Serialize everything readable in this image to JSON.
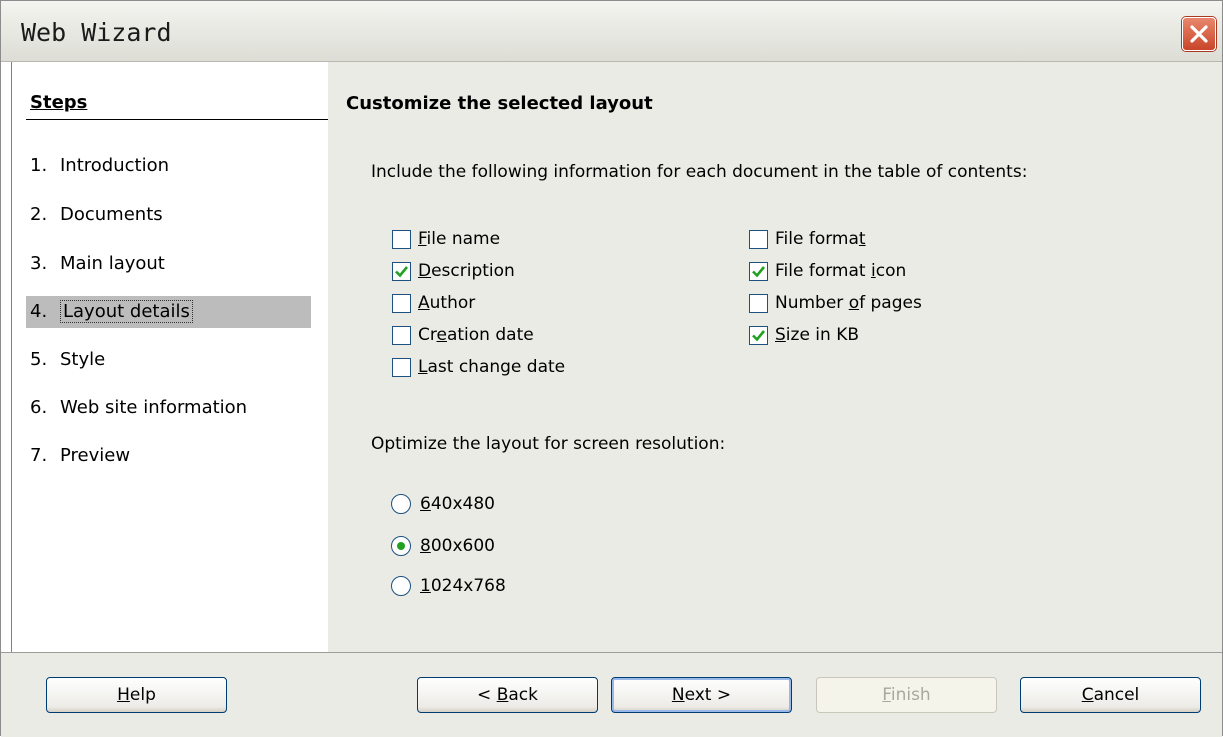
{
  "window": {
    "title": "Web Wizard"
  },
  "sidebar": {
    "heading": "Steps",
    "steps": [
      {
        "num": "1.",
        "label": "Introduction"
      },
      {
        "num": "2.",
        "label": "Documents"
      },
      {
        "num": "3.",
        "label": "Main layout"
      },
      {
        "num": "4.",
        "label": "Layout details"
      },
      {
        "num": "5.",
        "label": "Style"
      },
      {
        "num": "6.",
        "label": "Web site information"
      },
      {
        "num": "7.",
        "label": "Preview"
      }
    ],
    "active_step": "4. Layout details"
  },
  "main": {
    "title": "Customize the selected layout",
    "include_label": "Include the following information for each document in the table of contents:",
    "checkboxes": {
      "file_name": {
        "label_pre": "",
        "mnemonic": "F",
        "label_post": "ile name",
        "checked": false
      },
      "description": {
        "label_pre": "",
        "mnemonic": "D",
        "label_post": "escription",
        "checked": true
      },
      "author": {
        "label_pre": "",
        "mnemonic": "A",
        "label_post": "uthor",
        "checked": false
      },
      "creation_date": {
        "label_pre": "Cr",
        "mnemonic": "e",
        "label_post": "ation date",
        "checked": false
      },
      "last_change_date": {
        "label_pre": "",
        "mnemonic": "L",
        "label_post": "ast change date",
        "checked": false
      },
      "file_format": {
        "label_pre": "File forma",
        "mnemonic": "t",
        "label_post": "",
        "checked": false
      },
      "file_format_icon": {
        "label_pre": "File format ",
        "mnemonic": "i",
        "label_post": "con",
        "checked": true
      },
      "number_of_pages": {
        "label_pre": "Number ",
        "mnemonic": "o",
        "label_post": "f pages",
        "checked": false
      },
      "size_in_kb": {
        "label_pre": "",
        "mnemonic": "S",
        "label_post": "ize in KB",
        "checked": true
      }
    },
    "resolution_label": "Optimize the layout for screen resolution:",
    "radios": {
      "r640": {
        "label_pre": "",
        "mnemonic": "6",
        "label_post": "40x480",
        "selected": false
      },
      "r800": {
        "label_pre": "",
        "mnemonic": "8",
        "label_post": "00x600",
        "selected": true
      },
      "r1024": {
        "label_pre": "",
        "mnemonic": "1",
        "label_post": "024x768",
        "selected": false
      }
    }
  },
  "footer": {
    "help": {
      "label_pre": "",
      "mnemonic": "H",
      "label_post": "elp"
    },
    "back": {
      "label_pre": "< ",
      "mnemonic": "B",
      "label_post": "ack"
    },
    "next": {
      "label_pre": "",
      "mnemonic": "N",
      "label_post": "ext >"
    },
    "finish": {
      "label_pre": "",
      "mnemonic": "F",
      "label_post": "inish",
      "disabled": true
    },
    "cancel": {
      "label_pre": "",
      "mnemonic": "C",
      "label_post": "ancel"
    }
  },
  "colors": {
    "check": "#21a121",
    "radio_dot": "#21a121",
    "active_step_bg": "#bcbcbc",
    "panel_bg": "#ebebe5",
    "close_button": "#c9452a"
  },
  "icons": {
    "close": "close-x-icon",
    "check": "checkmark-icon",
    "radio": "radio-dot-icon"
  }
}
